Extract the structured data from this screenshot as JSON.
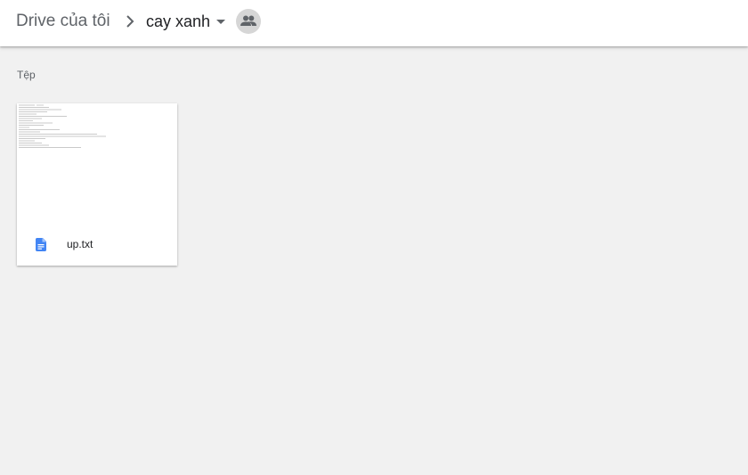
{
  "breadcrumb": {
    "root_label": "Drive của tôi",
    "current_label": "cay xanh",
    "separator_icon": "chevron-right-icon",
    "dropdown_icon": "arrow-drop-down-icon",
    "shared_icon": "people-icon"
  },
  "files_section": {
    "title": "Tệp"
  },
  "files": [
    {
      "name": "up.txt",
      "type_icon": "document-icon"
    }
  ],
  "colors": {
    "background": "#f1f1f1",
    "topbar": "#ffffff",
    "doc_icon": "#4285f4",
    "badge": "#d6d6d6"
  }
}
